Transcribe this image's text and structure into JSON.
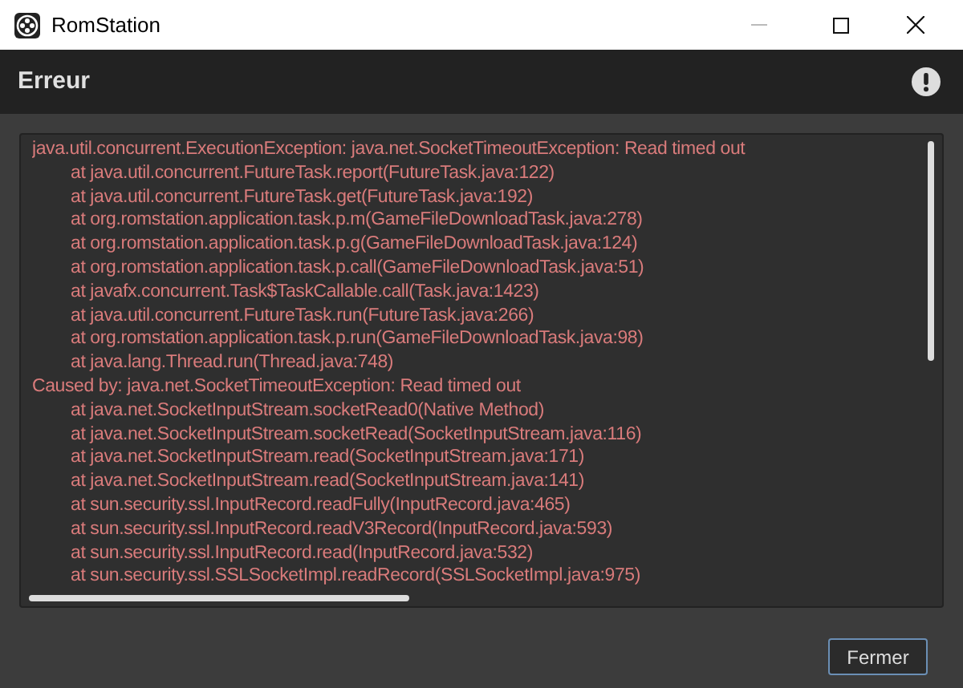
{
  "window": {
    "title": "RomStation"
  },
  "header": {
    "title": "Erreur"
  },
  "trace": [
    {
      "kind": "head",
      "text": "java.util.concurrent.ExecutionException: java.net.SocketTimeoutException: Read timed out"
    },
    {
      "kind": "frame",
      "text": "at java.util.concurrent.FutureTask.report(FutureTask.java:122)"
    },
    {
      "kind": "frame",
      "text": "at java.util.concurrent.FutureTask.get(FutureTask.java:192)"
    },
    {
      "kind": "frame",
      "text": "at org.romstation.application.task.p.m(GameFileDownloadTask.java:278)"
    },
    {
      "kind": "frame",
      "text": "at org.romstation.application.task.p.g(GameFileDownloadTask.java:124)"
    },
    {
      "kind": "frame",
      "text": "at org.romstation.application.task.p.call(GameFileDownloadTask.java:51)"
    },
    {
      "kind": "frame",
      "text": "at javafx.concurrent.Task$TaskCallable.call(Task.java:1423)"
    },
    {
      "kind": "frame",
      "text": "at java.util.concurrent.FutureTask.run(FutureTask.java:266)"
    },
    {
      "kind": "frame",
      "text": "at org.romstation.application.task.p.run(GameFileDownloadTask.java:98)"
    },
    {
      "kind": "frame",
      "text": "at java.lang.Thread.run(Thread.java:748)"
    },
    {
      "kind": "head",
      "text": "Caused by: java.net.SocketTimeoutException: Read timed out"
    },
    {
      "kind": "frame",
      "text": "at java.net.SocketInputStream.socketRead0(Native Method)"
    },
    {
      "kind": "frame",
      "text": "at java.net.SocketInputStream.socketRead(SocketInputStream.java:116)"
    },
    {
      "kind": "frame",
      "text": "at java.net.SocketInputStream.read(SocketInputStream.java:171)"
    },
    {
      "kind": "frame",
      "text": "at java.net.SocketInputStream.read(SocketInputStream.java:141)"
    },
    {
      "kind": "frame",
      "text": "at sun.security.ssl.InputRecord.readFully(InputRecord.java:465)"
    },
    {
      "kind": "frame",
      "text": "at sun.security.ssl.InputRecord.readV3Record(InputRecord.java:593)"
    },
    {
      "kind": "frame",
      "text": "at sun.security.ssl.InputRecord.read(InputRecord.java:532)"
    },
    {
      "kind": "frame",
      "text": "at sun.security.ssl.SSLSocketImpl.readRecord(SSLSocketImpl.java:975)"
    }
  ],
  "buttons": [
    "Fermer"
  ]
}
